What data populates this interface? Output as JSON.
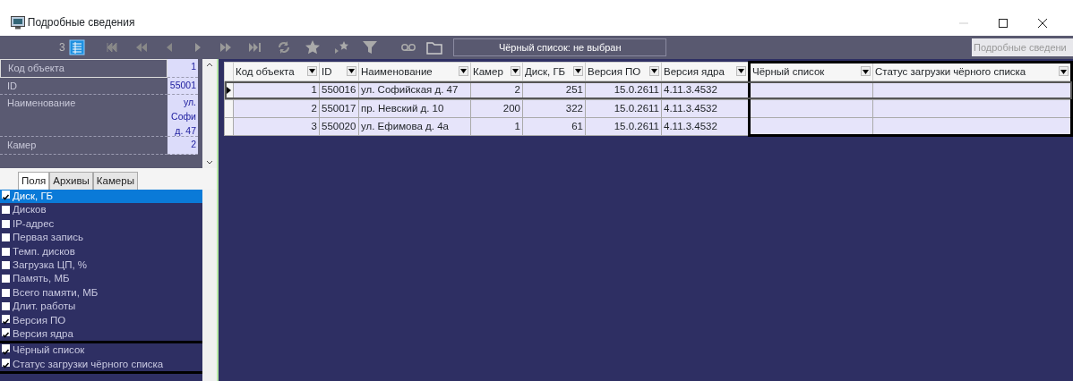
{
  "window": {
    "title": "Подробные сведения"
  },
  "toolbar": {
    "page_count": "3",
    "filter_field": "Чёрный список: не выбран",
    "search": {
      "placeholder": "Подробные сведени"
    }
  },
  "properties": [
    {
      "label": "Код объекта",
      "value": "1",
      "selected": true
    },
    {
      "label": "ID",
      "value": "55001",
      "selected": false
    },
    {
      "label": "Наименование",
      "value": "ул. Софи д. 47",
      "selected": false
    },
    {
      "label": "Камер",
      "value": "2",
      "selected": false
    }
  ],
  "tabs": [
    {
      "label": "Поля",
      "selected": true
    },
    {
      "label": "Архивы",
      "selected": false
    },
    {
      "label": "Камеры",
      "selected": false
    }
  ],
  "fields": [
    {
      "label": "Диск, ГБ",
      "checked": true,
      "selected": true
    },
    {
      "label": "Дисков",
      "checked": false,
      "selected": false
    },
    {
      "label": "IP-адрес",
      "checked": false,
      "selected": false
    },
    {
      "label": "Первая запись",
      "checked": false,
      "selected": false
    },
    {
      "label": "Темп. дисков",
      "checked": false,
      "selected": false
    },
    {
      "label": "Загрузка ЦП, %",
      "checked": false,
      "selected": false
    },
    {
      "label": "Память, МБ",
      "checked": false,
      "selected": false
    },
    {
      "label": "Всего памяти, МБ",
      "checked": false,
      "selected": false
    },
    {
      "label": "Длит. работы",
      "checked": false,
      "selected": false
    },
    {
      "label": "Версия ПО",
      "checked": true,
      "selected": false
    },
    {
      "label": "Версия ядра",
      "checked": true,
      "selected": false
    },
    {
      "label": "Чёрный список",
      "checked": true,
      "selected": false
    },
    {
      "label": "Статус загрузки чёрного списка",
      "checked": true,
      "selected": false
    }
  ],
  "table": {
    "columns": [
      "Код объекта",
      "ID",
      "Наименование",
      "Камер",
      "Диск, ГБ",
      "Версия ПО",
      "Версия ядра",
      "Чёрный список",
      "Статус загрузки чёрного списка"
    ],
    "rows": [
      {
        "selected": true,
        "cells": [
          "1",
          "550016",
          "ул. Софийская д. 47",
          "2",
          "251",
          "15.0.2611",
          "4.11.3.4532",
          "",
          ""
        ]
      },
      {
        "selected": false,
        "cells": [
          "2",
          "550017",
          "пр. Невский д. 10",
          "200",
          "322",
          "15.0.2611",
          "4.11.3.4532",
          "",
          ""
        ]
      },
      {
        "selected": false,
        "cells": [
          "3",
          "550020",
          "ул. Ефимова д. 4а",
          "1",
          "61",
          "15.0.2611",
          "4.11.3.4532",
          "",
          ""
        ]
      }
    ]
  }
}
